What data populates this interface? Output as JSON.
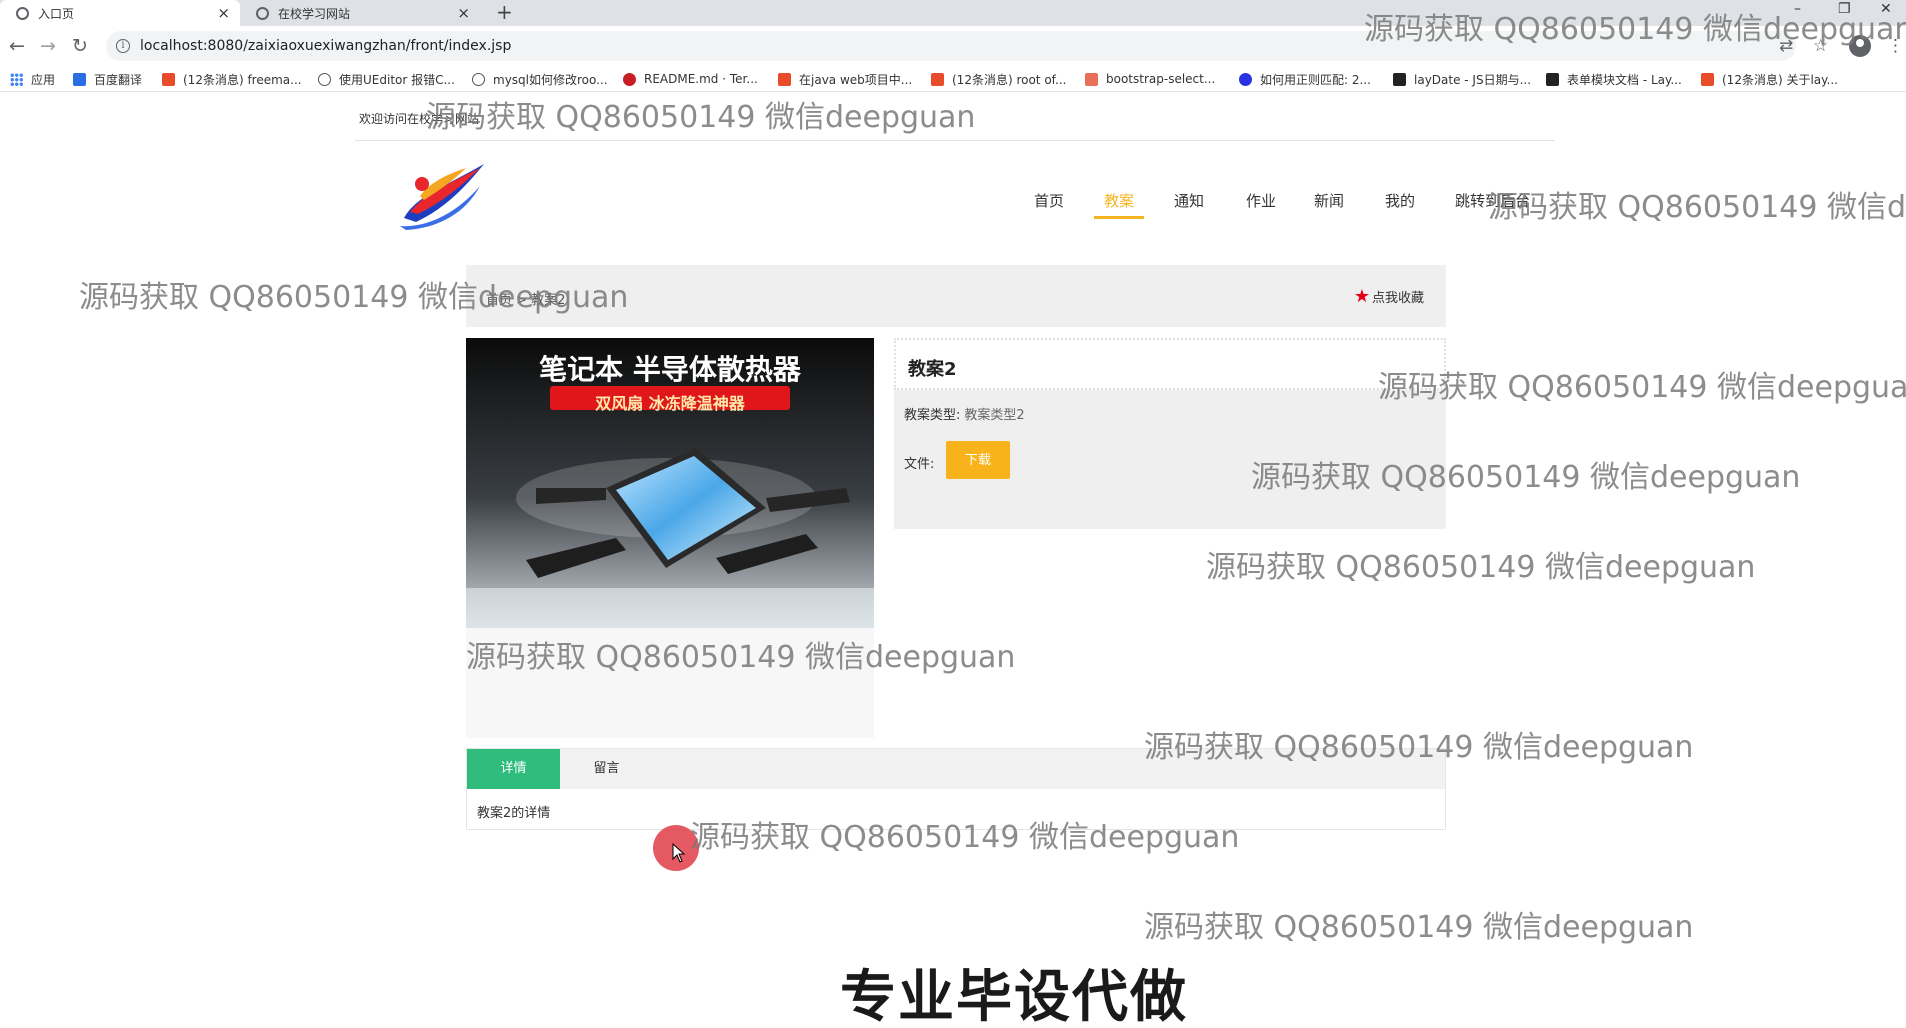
{
  "browser": {
    "tabs": [
      {
        "title": "入口页",
        "close": "×"
      },
      {
        "title": "在校学习网站",
        "close": "×"
      }
    ],
    "new_tab": "+",
    "window_controls": {
      "minimize": "–",
      "restore": "❐",
      "close": "✕"
    },
    "nav": {
      "back": "←",
      "forward": "→",
      "reload": "↻"
    },
    "url": "localhost:8080/zaixiaoxuexiwangzhan/front/index.jsp",
    "bookmarks": [
      {
        "label": "应用",
        "icon": "apps-grid-icon",
        "color": "#4285f4"
      },
      {
        "label": "百度翻译",
        "icon": "baidu-translate-icon",
        "color": "#2b6de5"
      },
      {
        "label": "(12条消息) freema...",
        "icon": "csdn-icon",
        "color": "#e94c2b"
      },
      {
        "label": "使用UEditor 报错C...",
        "icon": "link-icon",
        "color": "#555555"
      },
      {
        "label": "mysql如何修改roo...",
        "icon": "link-icon",
        "color": "#555555"
      },
      {
        "label": "README.md · Ter...",
        "icon": "gitee-icon",
        "color": "#c71d23"
      },
      {
        "label": "在java web项目中...",
        "icon": "csdn-icon",
        "color": "#e94c2b"
      },
      {
        "label": "(12条消息) root of...",
        "icon": "csdn-icon",
        "color": "#e94c2b"
      },
      {
        "label": "bootstrap-select...",
        "icon": "jianshu-icon",
        "color": "#ea6f5a"
      },
      {
        "label": "如何用正则匹配: 2...",
        "icon": "baidu-paw-icon",
        "color": "#2932e1"
      },
      {
        "label": "layDate - JS日期与...",
        "icon": "layui-icon",
        "color": "#222222"
      },
      {
        "label": "表单模块文档 - Lay...",
        "icon": "layui-icon",
        "color": "#222222"
      },
      {
        "label": "(12条消息) 关于lay...",
        "icon": "csdn-icon",
        "color": "#e94c2b"
      }
    ]
  },
  "page": {
    "welcome": "欢迎访问在校学习网站",
    "nav_items": [
      "首页",
      "教案",
      "通知",
      "作业",
      "新闻",
      "我的",
      "跳转到后台"
    ],
    "active_nav": "教案",
    "accent": "#f5b521",
    "breadcrumb": "首页 > 教案2",
    "favorite": "点我收藏",
    "product_image_text": {
      "headline": "笔记本 半导体散热器",
      "subline": "双风扇 冰冻降温神器"
    },
    "detail": {
      "title": "教案2",
      "type_label": "教案类型:",
      "type_value": "教案类型2",
      "file_label": "文件:",
      "download_button": "下载"
    },
    "tabs": {
      "items": [
        "详情",
        "留言"
      ],
      "active": "详情",
      "active_color": "#2fbc7d",
      "content": "教案2的详情"
    }
  },
  "overlay": {
    "watermark": "源码获取 QQ86050149 微信deepguan",
    "caption": "专业毕设代做"
  }
}
